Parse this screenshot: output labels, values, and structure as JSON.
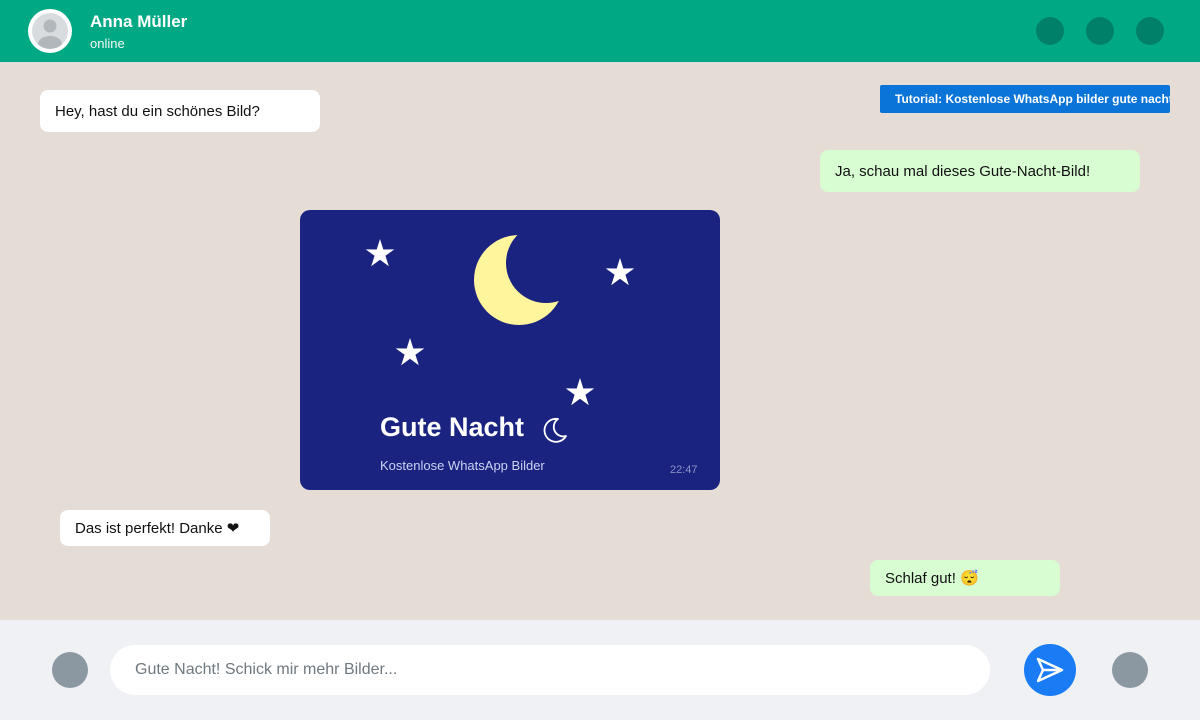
{
  "header": {
    "contact_name": "Anna Müller",
    "status": "online",
    "avatar_icon": "avatar-icon",
    "actions": [
      "video-call-icon",
      "voice-call-icon",
      "menu-icon"
    ]
  },
  "tutorial_banner": "Tutorial: Kostenlose WhatsApp bilder gute nacht",
  "messages": [
    {
      "direction": "incoming",
      "text": "Hey, hast du ein schönes Bild?"
    },
    {
      "direction": "outgoing",
      "text": "Ja, schau mal dieses Gute-Nacht-Bild!"
    },
    {
      "direction": "outgoing",
      "type": "image",
      "image": {
        "title": "Gute Nacht",
        "title_icon": "crescent-moon-icon",
        "subtitle": "Kostenlose WhatsApp Bilder",
        "time": "22:47",
        "moon_icon": "crescent-moon-icon",
        "star_icon": "star-icon",
        "star_count": 4
      }
    },
    {
      "direction": "incoming",
      "text": "Das ist perfekt! Danke ❤"
    },
    {
      "direction": "outgoing",
      "text": "Schlaf gut! 😴"
    }
  ],
  "input_bar": {
    "emoji_icon": "emoji-icon",
    "message_placeholder": "Gute Nacht! Schick mir mehr Bilder...",
    "send_icon": "send-icon",
    "mic_icon": "microphone-icon"
  },
  "colors": {
    "header": "#00a884",
    "chat_background": "#e5ddd5",
    "incoming_bubble": "#ffffff",
    "outgoing_bubble": "#d9fdd3",
    "image_background": "#1b2380",
    "moon": "#fff59d",
    "tutorial_banner": "#0b74d8",
    "send_button": "#1a7cf5"
  }
}
